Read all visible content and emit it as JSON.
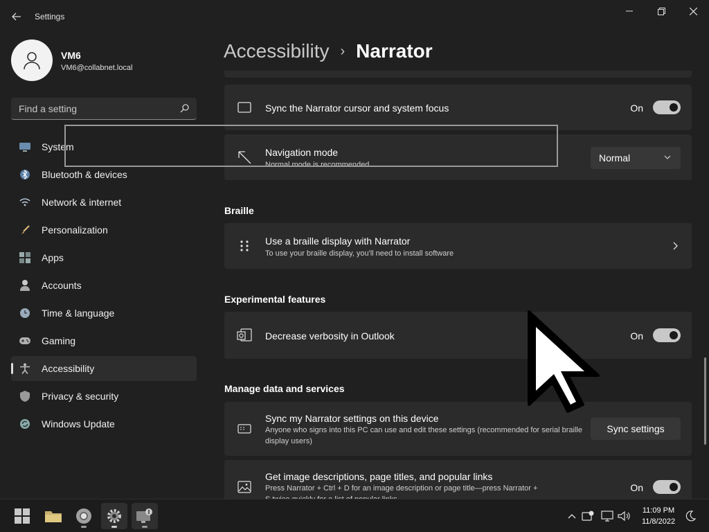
{
  "window": {
    "app_title": "Settings",
    "back_icon": "back-arrow-icon",
    "controls": [
      "minimize-icon",
      "maximize-icon",
      "close-icon"
    ]
  },
  "profile": {
    "name": "VM6",
    "email": "VM6@collabnet.local"
  },
  "search": {
    "placeholder": "Find a setting"
  },
  "nav": {
    "items": [
      {
        "label": "System",
        "icon": "display-icon"
      },
      {
        "label": "Bluetooth & devices",
        "icon": "bluetooth-icon"
      },
      {
        "label": "Network & internet",
        "icon": "wifi-icon"
      },
      {
        "label": "Personalization",
        "icon": "brush-icon"
      },
      {
        "label": "Apps",
        "icon": "apps-icon"
      },
      {
        "label": "Accounts",
        "icon": "person-icon"
      },
      {
        "label": "Time & language",
        "icon": "clock-globe-icon"
      },
      {
        "label": "Gaming",
        "icon": "gamepad-icon"
      },
      {
        "label": "Accessibility",
        "icon": "accessibility-icon",
        "active": true
      },
      {
        "label": "Privacy & security",
        "icon": "shield-icon"
      },
      {
        "label": "Windows Update",
        "icon": "update-icon"
      }
    ]
  },
  "breadcrumb": {
    "parent": "Accessibility",
    "separator": "›",
    "current": "Narrator"
  },
  "cards": {
    "sync_cursor": {
      "title": "Sync the Narrator cursor and system focus",
      "toggle_label": "On"
    },
    "navigation_mode": {
      "title": "Navigation mode",
      "desc": "Normal mode is recommended",
      "value": "Normal"
    },
    "braille": {
      "title": "Use a braille display with Narrator",
      "desc": "To use your braille display, you'll need to install software"
    },
    "verbosity": {
      "title": "Decrease verbosity in Outlook",
      "toggle_label": "On"
    },
    "sync_settings": {
      "title": "Sync my Narrator settings on this device",
      "desc": "Anyone who signs into this PC can use and edit these settings (recommended for serial braille display users)",
      "button": "Sync settings"
    },
    "image_desc": {
      "title": "Get image descriptions, page titles, and popular links",
      "desc": "Press Narrator + Ctrl + D for an image description or page title—press Narrator + S twice quickly for a list of popular links",
      "toggle_label": "On"
    }
  },
  "sections": {
    "braille": "Braille",
    "experimental": "Experimental features",
    "manage_data": "Manage data and services"
  },
  "taskbar": {
    "apps": [
      "start-icon",
      "file-explorer-icon",
      "chrome-icon",
      "settings-icon",
      "remote-desktop-icon"
    ],
    "time": "11:09 PM",
    "date": "11/8/2022"
  },
  "colors": {
    "background": "#202020",
    "card": "#2b2b2b",
    "toggle_on": "#c8c8c8"
  }
}
